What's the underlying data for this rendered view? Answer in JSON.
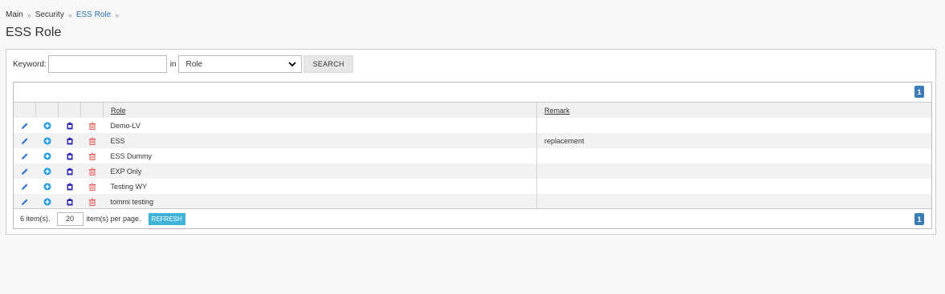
{
  "breadcrumb": {
    "items": [
      "Main",
      "Security"
    ],
    "current": "ESS Role"
  },
  "page": {
    "title": "ESS Role"
  },
  "search": {
    "keyword_label": "Keyword:",
    "keyword_value": "",
    "in_label": "in",
    "field_value": "Role",
    "button_label": "SEARCH"
  },
  "grid": {
    "pager_top_page": "1",
    "columns": {
      "role": "Role",
      "remark": "Remark"
    },
    "rows": [
      {
        "role": "Demo-LV",
        "remark": ""
      },
      {
        "role": "ESS",
        "remark": "replacement"
      },
      {
        "role": "ESS Dummy",
        "remark": ""
      },
      {
        "role": "EXP Only",
        "remark": ""
      },
      {
        "role": "Testing WY",
        "remark": ""
      },
      {
        "role": "tommi testing",
        "remark": ""
      }
    ],
    "footer": {
      "count_text": "6 item(s).",
      "page_size": "20",
      "per_page_text": "item(s) per page.",
      "refresh_label": "REFRESH",
      "pager_bottom_page": "1"
    }
  },
  "colors": {
    "link": "#2a6fb5",
    "edit_icon": "#2d6fd1",
    "add_icon": "#1a9ae0",
    "copy_icon": "#2d29b8",
    "delete_icon": "#e45a5a",
    "refresh_button": "#3fb3d8",
    "pager": "#3c7db8"
  },
  "icons": {
    "edit": "pencil-icon",
    "add": "plus-circle-icon",
    "copy": "clipboard-icon",
    "delete": "trash-icon"
  }
}
